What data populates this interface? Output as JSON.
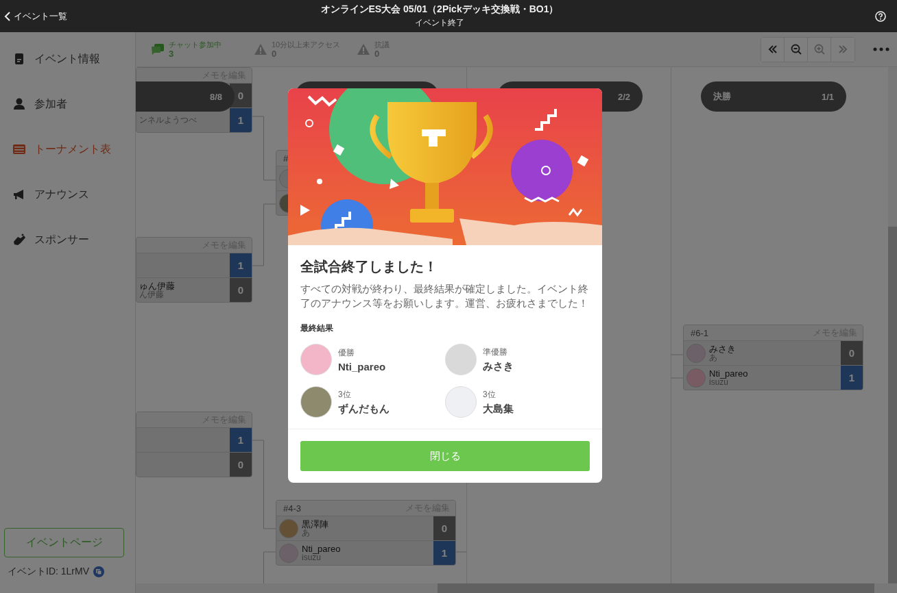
{
  "header": {
    "back_link": "イベント一覧",
    "title": "オンラインES大会 05/01（2Pickデッキ交換戦・BO1）",
    "subtitle": "イベント終了"
  },
  "sidebar": {
    "items": [
      {
        "label": "イベント情報",
        "selected": false
      },
      {
        "label": "参加者",
        "selected": false
      },
      {
        "label": "トーナメント表",
        "selected": true
      },
      {
        "label": "アナウンス",
        "selected": false
      },
      {
        "label": "スポンサー",
        "selected": false
      }
    ],
    "event_page_button": "イベントページ",
    "event_id": "イベントID: 1LrMV"
  },
  "stats": [
    {
      "kind": "chat",
      "label": "チャット参加中",
      "value": "3"
    },
    {
      "kind": "warning",
      "label": "10分以上未アクセス",
      "value": "0"
    },
    {
      "kind": "warning",
      "label": "抗議",
      "value": "0"
    }
  ],
  "bracket": {
    "rounds": [
      {
        "count": "8/8"
      },
      {
        "count": "2/2"
      },
      {
        "label": "決勝",
        "count": "1/1"
      }
    ],
    "matches": [
      {
        "memo_link": "メモを編集",
        "players": [
          {
            "score": "0",
            "winner": false
          },
          {
            "sub": "ンネルようつべ",
            "score": "1",
            "winner": true
          }
        ]
      },
      {
        "number": "#"
      },
      {
        "memo_link": "メモを編集",
        "players": [
          {
            "score": "1",
            "winner": true
          },
          {
            "name": "ゅん伊藤",
            "sub": "ん伊藤",
            "score": "0",
            "winner": false
          }
        ]
      },
      {
        "memo_link": "メモを編集",
        "players": [
          {
            "score": "1",
            "winner": true
          },
          {
            "score": "0",
            "winner": false
          }
        ]
      },
      {
        "number": "#4-3",
        "memo_link": "メモを編集",
        "players": [
          {
            "name": "黒澤陣",
            "sub": "あ",
            "score": "0",
            "winner": false
          },
          {
            "name": "Nti_pareo",
            "sub": "isuzu",
            "score": "1",
            "winner": true
          }
        ]
      },
      {
        "number": "#6-1",
        "memo_link": "メモを編集",
        "players": [
          {
            "name": "みさき",
            "sub": "あ",
            "score": "0",
            "winner": false
          },
          {
            "name": "Nti_pareo",
            "sub": "isuzu",
            "score": "1",
            "winner": true
          }
        ]
      }
    ]
  },
  "modal": {
    "title": "全試合終了しました！",
    "message": "すべての対戦が終わり、最終結果が確定しました。イベント終了のアナウンス等をお願いします。運営、お疲れさまでした！",
    "results_heading": "最終結果",
    "results": [
      {
        "rank": "優勝",
        "name": "Nti_pareo"
      },
      {
        "rank": "準優勝",
        "name": "みさき"
      },
      {
        "rank": "3位",
        "name": "ずんだもん"
      },
      {
        "rank": "3位",
        "name": "大島集"
      }
    ],
    "close_button": "閉じる"
  }
}
